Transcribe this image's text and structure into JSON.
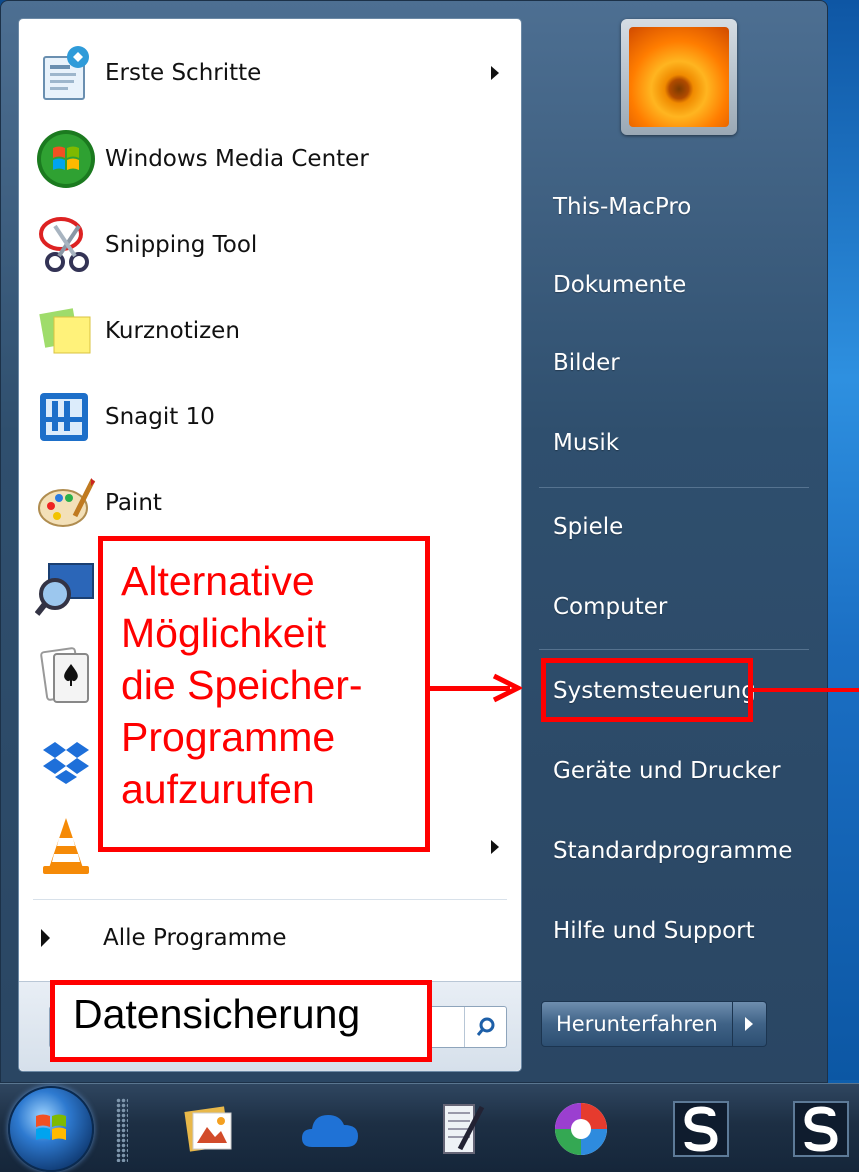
{
  "programs": [
    {
      "label": "Erste Schritte",
      "icon": "getting-started-icon",
      "has_submenu": true
    },
    {
      "label": "Windows Media Center",
      "icon": "windows-media-center-icon",
      "has_submenu": false
    },
    {
      "label": "Snipping Tool",
      "icon": "scissors-icon",
      "has_submenu": false
    },
    {
      "label": "Kurznotizen",
      "icon": "sticky-notes-icon",
      "has_submenu": false
    },
    {
      "label": "Snagit 10",
      "icon": "snagit-icon",
      "has_submenu": false
    },
    {
      "label": "Paint",
      "icon": "paint-palette-icon",
      "has_submenu": false
    },
    {
      "label": "",
      "icon": "magnifier-monitor-icon",
      "has_submenu": false
    },
    {
      "label": "",
      "icon": "solitaire-cards-icon",
      "has_submenu": false
    },
    {
      "label": "",
      "icon": "dropbox-icon",
      "has_submenu": false
    },
    {
      "label": "",
      "icon": "vlc-cone-icon",
      "has_submenu": true
    }
  ],
  "all_programs_label": "Alle Programme",
  "search": {
    "value": "",
    "annotation_text": "Datensicherung"
  },
  "right_items": [
    "This-MacPro",
    "Dokumente",
    "Bilder",
    "Musik",
    "Spiele",
    "Computer",
    "Systemsteuerung",
    "Geräte und Drucker",
    "Standardprogramme",
    "Hilfe und Support"
  ],
  "shutdown_label": "Herunterfahren",
  "callout": {
    "lines": [
      "Alternative",
      "Möglichkeit",
      "die Speicher-",
      "Programme",
      "aufzurufen"
    ]
  },
  "taskbar_icons": [
    "start-orb-icon",
    "photo-gallery-icon",
    "onedrive-cloud-icon",
    "notepad-pen-icon",
    "picasa-icon",
    "snagit-s-icon",
    "snagit-editor-s-icon"
  ],
  "colors": {
    "annotation_red": "#ff0000",
    "menu_right_bg": "#2f4f6e",
    "taskbar_bg": "#1d2f44"
  }
}
